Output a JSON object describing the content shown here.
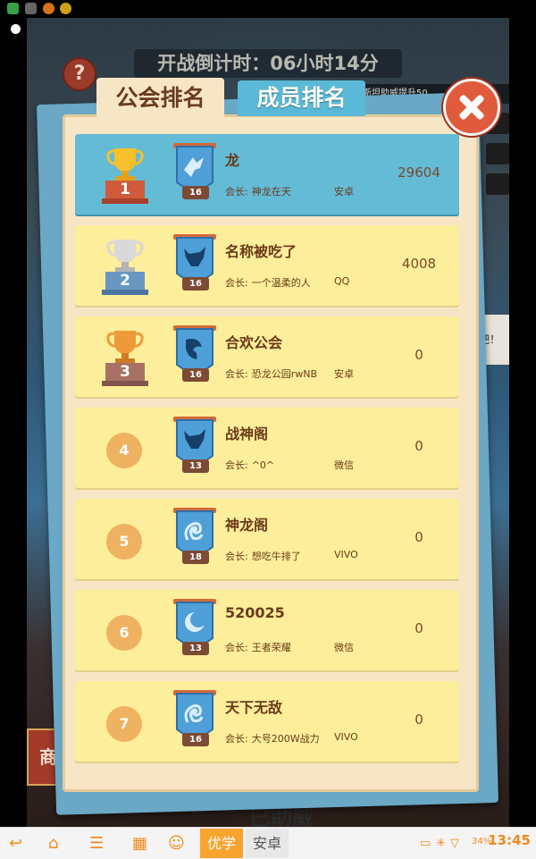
{
  "game": {
    "countdown": "开战倒计时：06小时14分",
    "help_label": "?",
    "notice_text": "赛斯坦助威提升50",
    "side_bubble_text": "吧！",
    "left_button_text": "商",
    "bottom_text": "已助威"
  },
  "panel": {
    "tabs": [
      {
        "label": "公会排名",
        "active": true
      },
      {
        "label": "成员排名",
        "active": false
      }
    ],
    "leader_prefix": "会长:",
    "rows": [
      {
        "rank": "1",
        "name": "龙",
        "level": "16",
        "leader": "神龙在天",
        "platform": "安卓",
        "score": "29604"
      },
      {
        "rank": "2",
        "name": "名称被吃了",
        "level": "16",
        "leader": "一个温柔的人",
        "platform": "QQ",
        "score": "4008"
      },
      {
        "rank": "3",
        "name": "合欢公会",
        "level": "16",
        "leader": "恐龙公园rwNB",
        "platform": "安卓",
        "score": "0"
      },
      {
        "rank": "4",
        "name": "战神阁",
        "level": "13",
        "leader": "^0^",
        "platform": "微信",
        "score": "0"
      },
      {
        "rank": "5",
        "name": "神龙阁",
        "level": "18",
        "leader": "想吃牛排了",
        "platform": "VIVO",
        "score": "0"
      },
      {
        "rank": "6",
        "name": "520025",
        "level": "13",
        "leader": "王者荣耀",
        "platform": "微信",
        "score": "0"
      },
      {
        "rank": "7",
        "name": "天下无敌",
        "level": "16",
        "leader": "大号200W战力",
        "platform": "VIVO",
        "score": "0"
      }
    ]
  },
  "navbar": {
    "tabs": [
      {
        "label": "优学",
        "active": true
      },
      {
        "label": "安卓",
        "active": false
      }
    ],
    "battery": "34%",
    "time": "13:45"
  },
  "colors": {
    "accent_blue": "#63bbd6",
    "row_yellow": "#fcee9a",
    "text_brown": "#6b3a1a",
    "close_red": "#e05a3c",
    "nav_orange": "#f08a1c"
  }
}
